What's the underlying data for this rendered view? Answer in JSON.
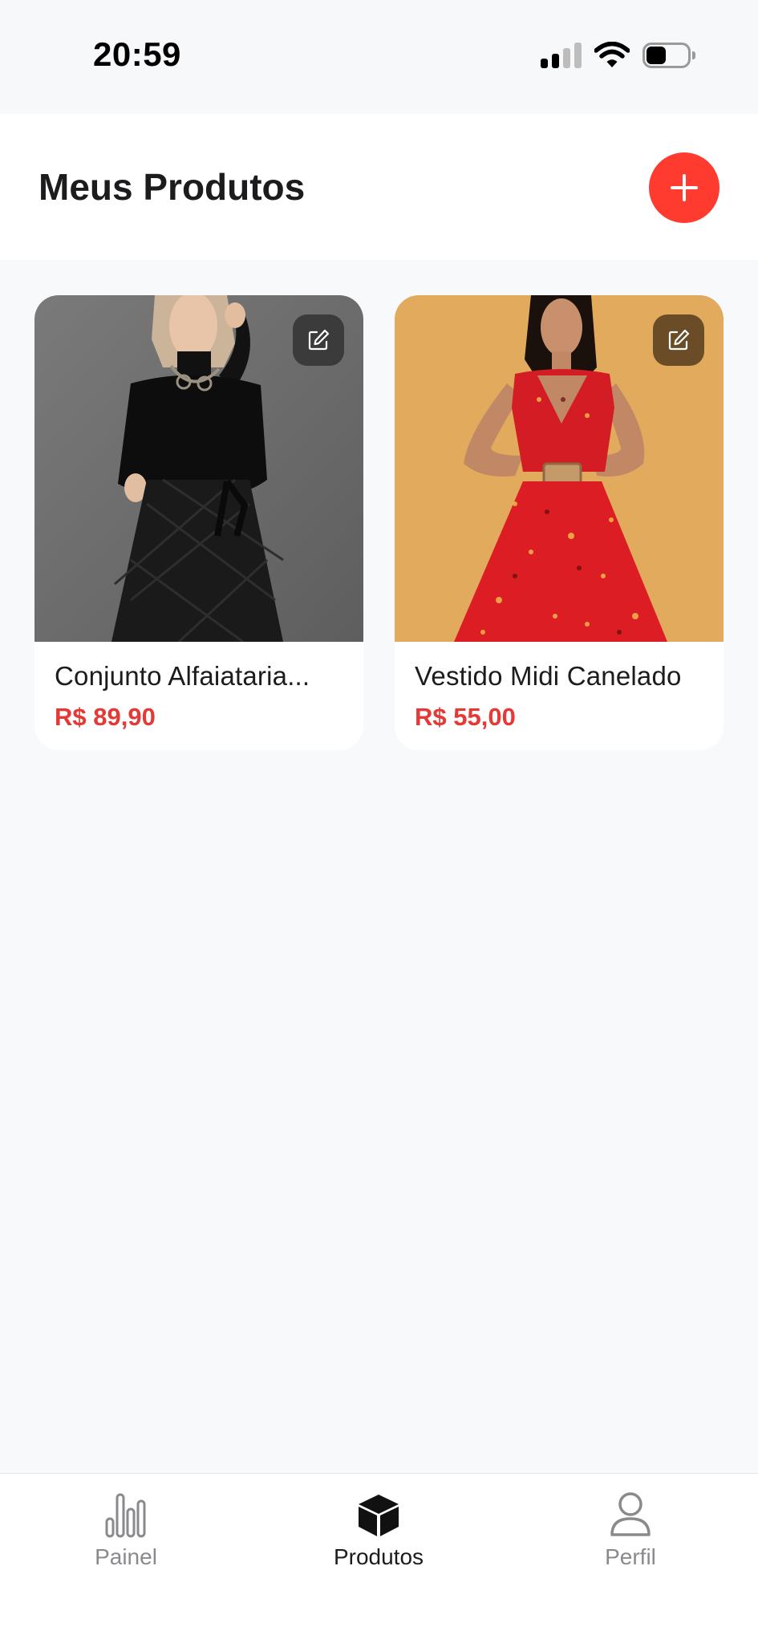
{
  "status_bar": {
    "time": "20:59",
    "icons": [
      "signal-icon",
      "wifi-icon",
      "battery-icon"
    ]
  },
  "header": {
    "title": "Meus Produtos",
    "add_icon": "plus-icon"
  },
  "products": [
    {
      "name": "Conjunto Alfaiataria...",
      "price": "R$ 89,90",
      "edit_icon": "edit-icon"
    },
    {
      "name": "Vestido Midi Canelado",
      "price": "R$ 55,00",
      "edit_icon": "edit-icon"
    }
  ],
  "bottom_nav": {
    "items": [
      {
        "label": "Painel",
        "icon": "bar-chart-icon",
        "active": false
      },
      {
        "label": "Produtos",
        "icon": "box-icon",
        "active": true
      },
      {
        "label": "Perfil",
        "icon": "person-icon",
        "active": false
      }
    ]
  },
  "colors": {
    "accent": "#ff3b30",
    "price": "#e53935",
    "background": "#f8f9fb"
  }
}
